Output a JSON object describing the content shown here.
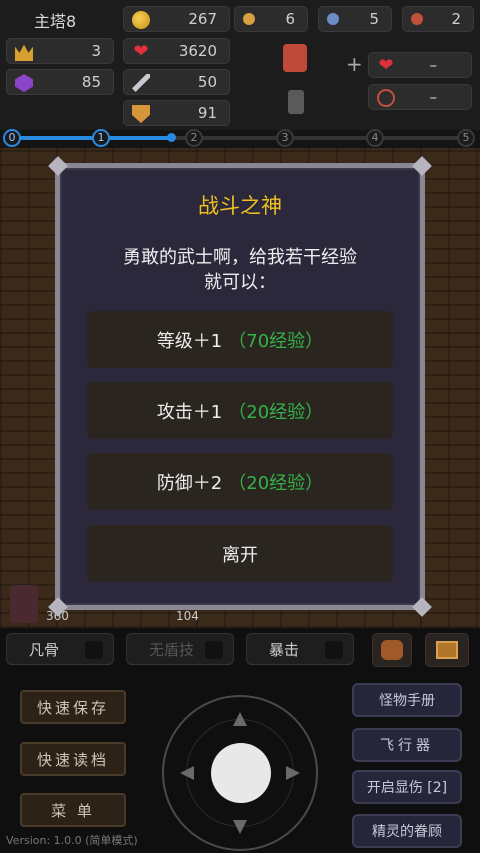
{
  "hud": {
    "floor": "主塔8",
    "gold": "267",
    "key_yellow": "6",
    "key_blue": "5",
    "key_red": "2",
    "level": "3",
    "hp": "3620",
    "exp": "85",
    "attack": "50",
    "defense": "91",
    "plus": "+",
    "equip_slot_1": "–",
    "equip_slot_2": "–"
  },
  "progress": {
    "nodes": [
      "0",
      "1",
      "2",
      "3",
      "4",
      "5"
    ]
  },
  "dialog": {
    "title": "战斗之神",
    "message_line1": "勇敢的武士啊，给我若干经验",
    "message_line2": "就可以：",
    "options": [
      {
        "label": "等级＋1",
        "cost": "（70经验）"
      },
      {
        "label": "攻击＋1",
        "cost": "（20经验）"
      },
      {
        "label": "防御＋2",
        "cost": "（20经验）"
      }
    ],
    "leave": "离开"
  },
  "behind": {
    "left_num": "360",
    "mid_num": "104"
  },
  "toggles": [
    "凡骨",
    "无盾技",
    "暴击"
  ],
  "left_buttons": [
    "快速保存",
    "快速读档",
    "菜 单"
  ],
  "right_buttons": [
    "怪物手册",
    "飞行器",
    "开启显伤 [2]",
    "精灵的眷顾"
  ],
  "version": "Version: 1.0.0 (简单模式)",
  "colors": {
    "title": "#f0c020",
    "cost": "#33b24a",
    "progress": "#2a8adf"
  }
}
